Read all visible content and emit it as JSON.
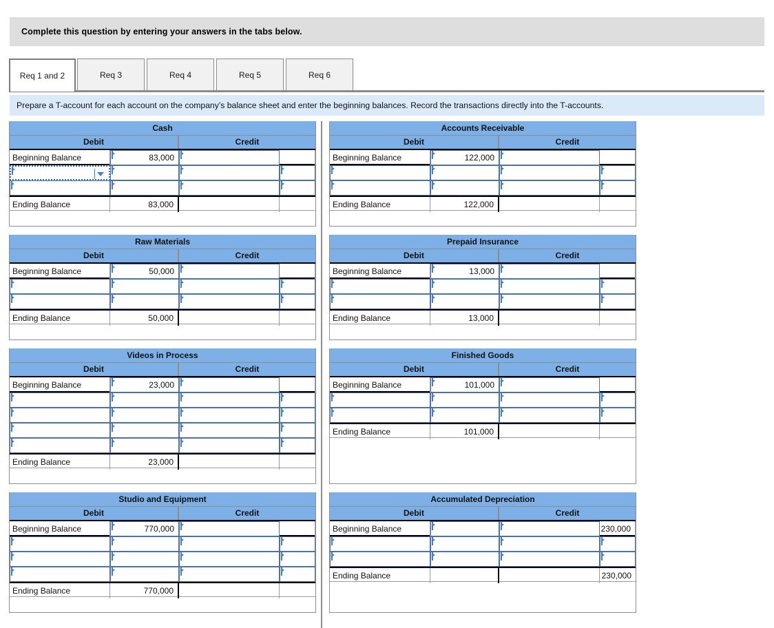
{
  "banner": {
    "text": "Complete this question by entering your answers in the tabs below."
  },
  "tabs": [
    {
      "label": "Req 1 and 2",
      "active": true
    },
    {
      "label": "Req 3",
      "active": false
    },
    {
      "label": "Req 4",
      "active": false
    },
    {
      "label": "Req 5",
      "active": false
    },
    {
      "label": "Req 6",
      "active": false
    }
  ],
  "instruction": {
    "text": "Prepare a T-account for each account on the company’s balance sheet and enter the beginning balances. Record the transactions directly into the T-accounts."
  },
  "labels": {
    "debit": "Debit",
    "credit": "Credit",
    "beginning_balance": "Beginning Balance",
    "ending_balance": "Ending Balance"
  },
  "colors": {
    "header_blue": "#7cb0e6",
    "instruction_blue": "#dbeaf8",
    "banner_gray": "#dedede",
    "input_border": "#4a72a8",
    "selection": "#2f6fbd"
  },
  "accounts": [
    {
      "name": "Cash",
      "column": "left",
      "beginning": {
        "debit": "83,000",
        "credit": ""
      },
      "entry_rows": 2,
      "selected_row": 0,
      "ending": {
        "debit": "83,000",
        "credit": ""
      },
      "trailing_pad": 1
    },
    {
      "name": "Accounts Receivable",
      "column": "right",
      "beginning": {
        "debit": "122,000",
        "credit": ""
      },
      "entry_rows": 2,
      "selected_row": -1,
      "ending": {
        "debit": "122,000",
        "credit": ""
      },
      "trailing_pad": 1
    },
    {
      "name": "Raw Materials",
      "column": "left",
      "beginning": {
        "debit": "50,000",
        "credit": ""
      },
      "entry_rows": 2,
      "selected_row": -1,
      "ending": {
        "debit": "50,000",
        "credit": ""
      },
      "trailing_pad": 1
    },
    {
      "name": "Prepaid Insurance",
      "column": "right",
      "beginning": {
        "debit": "13,000",
        "credit": ""
      },
      "entry_rows": 2,
      "selected_row": -1,
      "ending": {
        "debit": "13,000",
        "credit": ""
      },
      "trailing_pad": 1
    },
    {
      "name": "Videos in Process",
      "column": "left",
      "beginning": {
        "debit": "23,000",
        "credit": ""
      },
      "entry_rows": 4,
      "selected_row": -1,
      "ending": {
        "debit": "23,000",
        "credit": ""
      },
      "trailing_pad": 1
    },
    {
      "name": "Finished Goods",
      "column": "right",
      "beginning": {
        "debit": "101,000",
        "credit": ""
      },
      "entry_rows": 2,
      "selected_row": -1,
      "ending": {
        "debit": "101,000",
        "credit": ""
      },
      "trailing_pad": 3
    },
    {
      "name": "Studio and Equipment",
      "column": "left",
      "beginning": {
        "debit": "770,000",
        "credit": ""
      },
      "entry_rows": 3,
      "selected_row": -1,
      "ending": {
        "debit": "770,000",
        "credit": ""
      },
      "trailing_pad": 1
    },
    {
      "name": "Accumulated Depreciation",
      "column": "right",
      "beginning": {
        "debit": "",
        "credit": "230,000"
      },
      "entry_rows": 2,
      "selected_row": -1,
      "ending": {
        "debit": "",
        "credit": "230,000"
      },
      "trailing_pad": 2
    }
  ]
}
